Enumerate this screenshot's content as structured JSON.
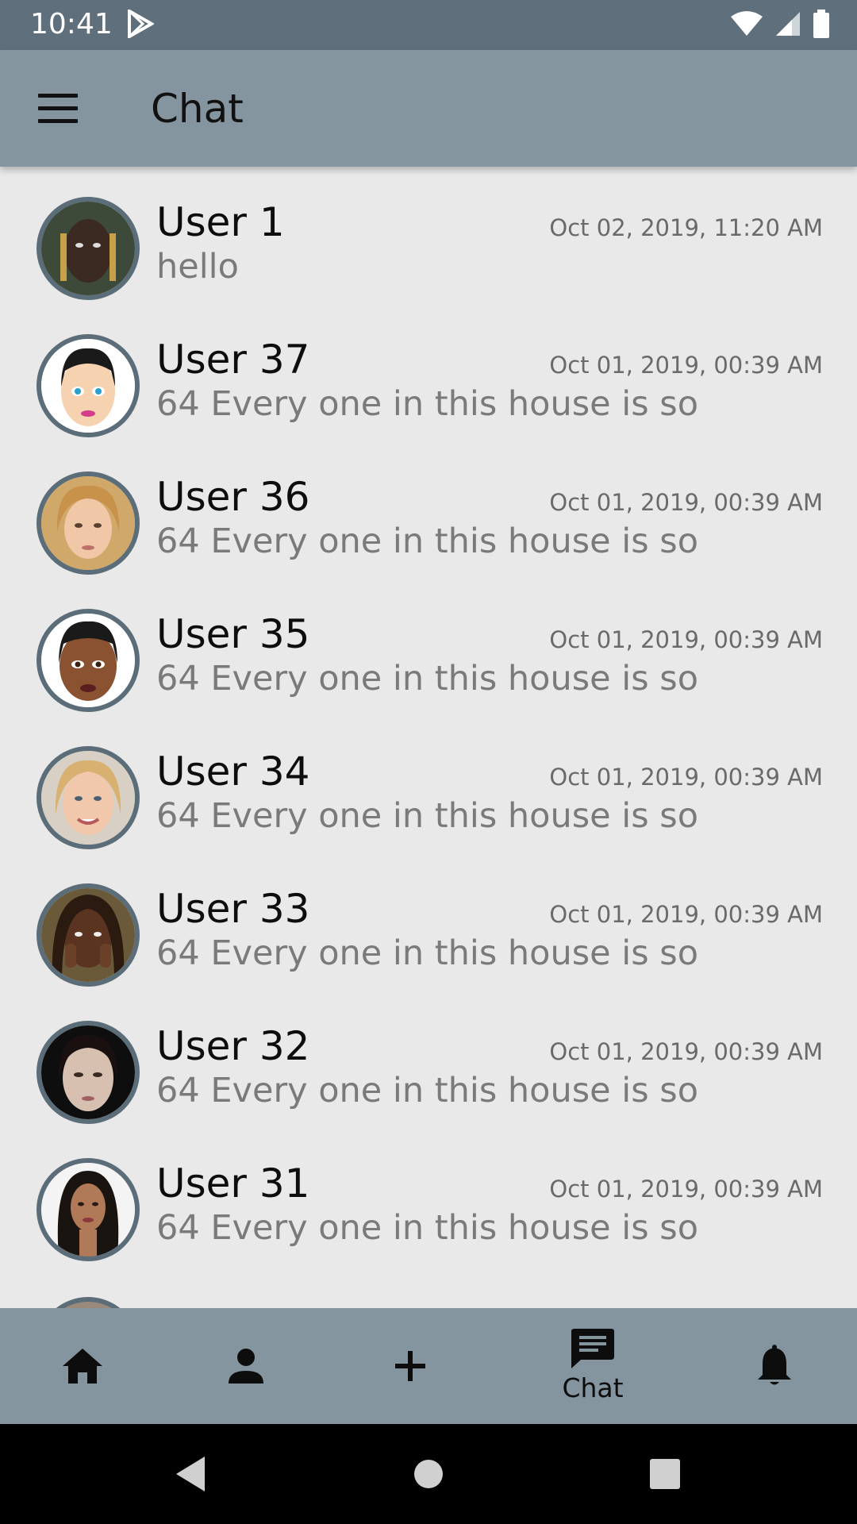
{
  "status_bar": {
    "time": "10:41",
    "icons": [
      "play-store-icon",
      "wifi-icon",
      "signal-icon",
      "battery-icon"
    ]
  },
  "app_bar": {
    "title": "Chat",
    "menu_icon": "menu-icon"
  },
  "chats": [
    {
      "name": "User 1",
      "time": "Oct 02, 2019, 11:20 AM",
      "message": "hello",
      "avatar": "avatar-photo-1"
    },
    {
      "name": "User 37",
      "time": "Oct 01, 2019, 00:39 AM",
      "message": "64 Every one in this house is so",
      "avatar": "avatar-cartoon-woman"
    },
    {
      "name": "User 36",
      "time": "Oct 01, 2019, 00:39 AM",
      "message": "64 Every one in this house is so",
      "avatar": "avatar-photo-36"
    },
    {
      "name": "User 35",
      "time": "Oct 01, 2019, 00:39 AM",
      "message": "64 Every one in this house is so",
      "avatar": "avatar-cartoon-dark"
    },
    {
      "name": "User 34",
      "time": "Oct 01, 2019, 00:39 AM",
      "message": "64 Every one in this house is so",
      "avatar": "avatar-photo-34"
    },
    {
      "name": "User 33",
      "time": "Oct 01, 2019, 00:39 AM",
      "message": "64 Every one in this house is so",
      "avatar": "avatar-photo-33"
    },
    {
      "name": "User 32",
      "time": "Oct 01, 2019, 00:39 AM",
      "message": "64 Every one in this house is so",
      "avatar": "avatar-photo-32"
    },
    {
      "name": "User 31",
      "time": "Oct 01, 2019, 00:39 AM",
      "message": "64 Every one in this house is so",
      "avatar": "avatar-photo-31"
    }
  ],
  "bottom_nav": {
    "items": [
      {
        "icon": "home-icon",
        "label": ""
      },
      {
        "icon": "person-icon",
        "label": ""
      },
      {
        "icon": "add-icon",
        "label": ""
      },
      {
        "icon": "chat-icon",
        "label": "Chat",
        "active": true
      },
      {
        "icon": "bell-icon",
        "label": ""
      }
    ]
  },
  "system_nav": [
    "back-icon",
    "home-circle-icon",
    "recents-icon"
  ],
  "colors": {
    "status_bar": "#5f707c",
    "app_bar": "#84959f",
    "background": "#e9e9e9",
    "avatar_ring": "#5b6d78",
    "message_text": "#7a7a7a"
  }
}
